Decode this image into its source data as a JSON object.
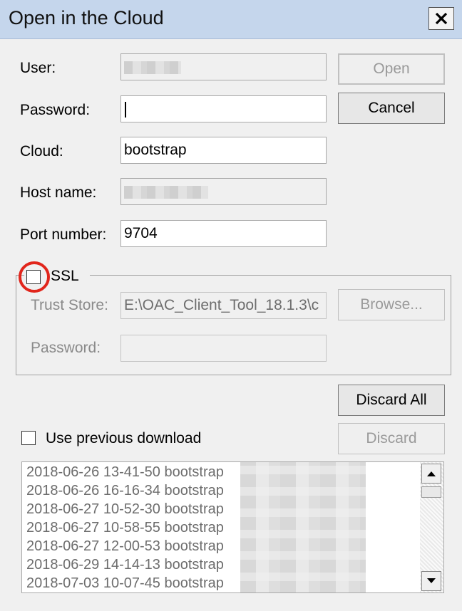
{
  "window": {
    "title": "Open in the Cloud"
  },
  "form": {
    "user_label": "User:",
    "password_label": "Password:",
    "cloud_label": "Cloud:",
    "cloud_value": "bootstrap",
    "host_label": "Host name:",
    "port_label": "Port number:",
    "port_value": "9704"
  },
  "buttons": {
    "open": "Open",
    "cancel": "Cancel",
    "browse": "Browse...",
    "discard_all": "Discard All",
    "discard": "Discard"
  },
  "ssl": {
    "checkbox_label": "SSL",
    "checked": false,
    "trust_store_label": "Trust Store:",
    "trust_store_value": "E:\\OAC_Client_Tool_18.1.3\\c",
    "password_label": "Password:"
  },
  "downloads": {
    "use_previous_label": "Use previous download",
    "checked": false,
    "items": [
      "2018-06-26 13-41-50 bootstrap",
      "2018-06-26 16-16-34 bootstrap",
      "2018-06-27 10-52-30 bootstrap",
      "2018-06-27 10-58-55 bootstrap",
      "2018-06-27 12-00-53 bootstrap",
      "2018-06-29 14-14-13 bootstrap",
      "2018-07-03 10-07-45 bootstrap"
    ]
  },
  "colors": {
    "highlight_ring": "#e1251b",
    "titlebar": "#c5d6ec"
  },
  "icons": {
    "close": "close-icon",
    "scroll_up": "scroll-up-arrow-icon",
    "scroll_down": "scroll-down-arrow-icon"
  }
}
